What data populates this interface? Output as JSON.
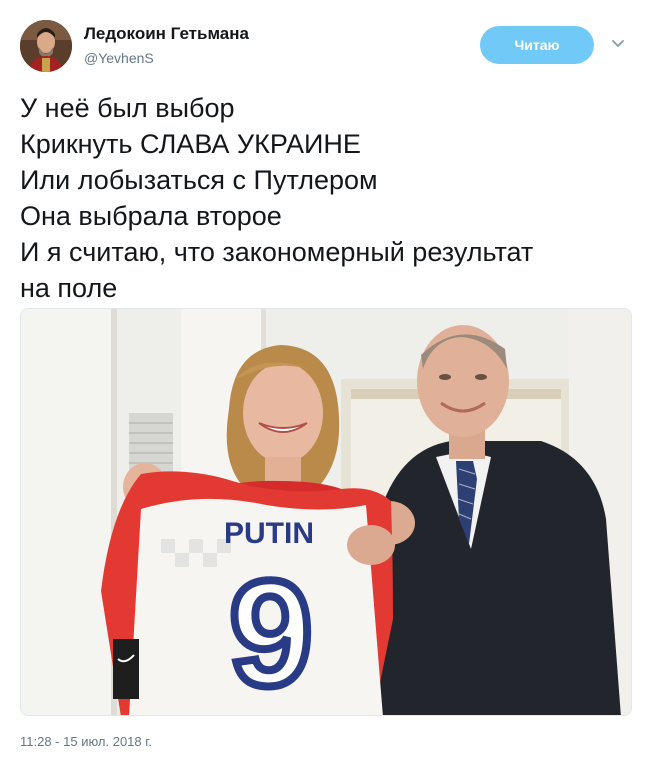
{
  "author": {
    "display_name": "Ледокоин Гетьмана",
    "handle": "@YevhenS",
    "avatar_icon": "portrait-avatar-icon"
  },
  "follow_button": {
    "label": "Читаю",
    "color": "#71c9f8"
  },
  "menu": {
    "icon": "chevron-down-icon"
  },
  "tweet": {
    "lines": [
      "У неё был выбор",
      "Крикнуть СЛАВА УКРАИНЕ",
      "Или лобызаться с Путлером",
      "Она выбрала второе",
      "И я считаю, что закономерный результат",
      "на поле"
    ],
    "timestamp": "11:28 - 15 июл. 2018 г."
  },
  "photo": {
    "jersey_name": "PUTIN",
    "jersey_number": "9"
  }
}
